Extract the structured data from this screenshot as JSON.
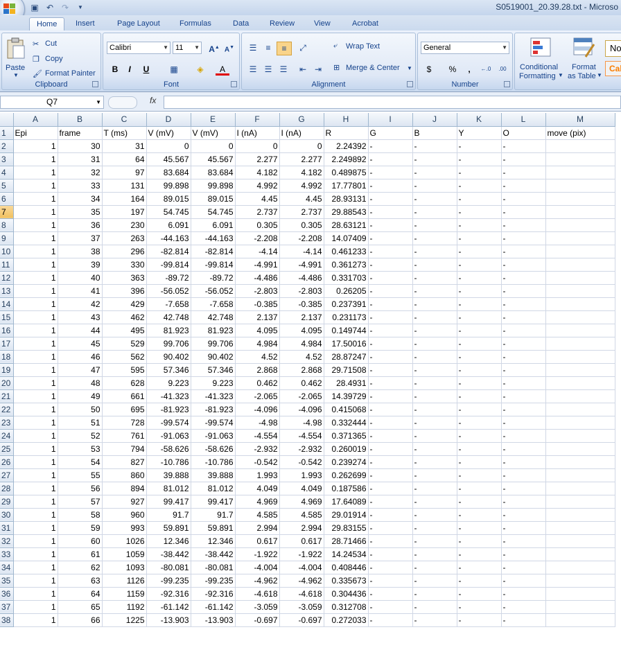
{
  "window": {
    "title": "S0519001_20.39.28.txt - Microso"
  },
  "tabs": [
    "Home",
    "Insert",
    "Page Layout",
    "Formulas",
    "Data",
    "Review",
    "View",
    "Acrobat"
  ],
  "clipboard": {
    "paste": "Paste",
    "cut": "Cut",
    "copy": "Copy",
    "format_painter": "Format Painter",
    "label": "Clipboard"
  },
  "font": {
    "name": "Calibri",
    "size": "11",
    "label": "Font"
  },
  "alignment": {
    "wrap_text": "Wrap Text",
    "merge_center": "Merge & Center",
    "label": "Alignment"
  },
  "number": {
    "format": "General",
    "label": "Number",
    "currency": "$",
    "percent": "%",
    "comma": ","
  },
  "styles": {
    "conditional": "Conditional",
    "conditional2": "Formatting",
    "format_as": "Format",
    "format_as2": "as Table",
    "normal": "No",
    "calc": "Cal"
  },
  "formula_bar": {
    "name_box": "Q7",
    "fx": "fx",
    "formula": ""
  },
  "sheet": {
    "columns": [
      "A",
      "B",
      "C",
      "D",
      "E",
      "F",
      "G",
      "H",
      "I",
      "J",
      "K",
      "L",
      "M"
    ],
    "header_row": [
      "Epi",
      "frame",
      "T (ms)",
      "V (mV)",
      "V (mV)",
      "I (nA)",
      "I (nA)",
      "R",
      "G",
      "B",
      "Y",
      "O",
      "move (pix)"
    ],
    "rows": [
      [
        "1",
        "30",
        "31",
        "0",
        "0",
        "0",
        "0",
        "2.24392",
        "-",
        "-",
        "-",
        "-",
        ""
      ],
      [
        "1",
        "31",
        "64",
        "45.567",
        "45.567",
        "2.277",
        "2.277",
        "2.249892",
        "-",
        "-",
        "-",
        "-",
        ""
      ],
      [
        "1",
        "32",
        "97",
        "83.684",
        "83.684",
        "4.182",
        "4.182",
        "0.489875",
        "-",
        "-",
        "-",
        "-",
        ""
      ],
      [
        "1",
        "33",
        "131",
        "99.898",
        "99.898",
        "4.992",
        "4.992",
        "17.77801",
        "-",
        "-",
        "-",
        "-",
        ""
      ],
      [
        "1",
        "34",
        "164",
        "89.015",
        "89.015",
        "4.45",
        "4.45",
        "28.93131",
        "-",
        "-",
        "-",
        "-",
        ""
      ],
      [
        "1",
        "35",
        "197",
        "54.745",
        "54.745",
        "2.737",
        "2.737",
        "29.88543",
        "-",
        "-",
        "-",
        "-",
        ""
      ],
      [
        "1",
        "36",
        "230",
        "6.091",
        "6.091",
        "0.305",
        "0.305",
        "28.63121",
        "-",
        "-",
        "-",
        "-",
        ""
      ],
      [
        "1",
        "37",
        "263",
        "-44.163",
        "-44.163",
        "-2.208",
        "-2.208",
        "14.07409",
        "-",
        "-",
        "-",
        "-",
        ""
      ],
      [
        "1",
        "38",
        "296",
        "-82.814",
        "-82.814",
        "-4.14",
        "-4.14",
        "0.461233",
        "-",
        "-",
        "-",
        "-",
        ""
      ],
      [
        "1",
        "39",
        "330",
        "-99.814",
        "-99.814",
        "-4.991",
        "-4.991",
        "0.361273",
        "-",
        "-",
        "-",
        "-",
        ""
      ],
      [
        "1",
        "40",
        "363",
        "-89.72",
        "-89.72",
        "-4.486",
        "-4.486",
        "0.331703",
        "-",
        "-",
        "-",
        "-",
        ""
      ],
      [
        "1",
        "41",
        "396",
        "-56.052",
        "-56.052",
        "-2.803",
        "-2.803",
        "0.26205",
        "-",
        "-",
        "-",
        "-",
        ""
      ],
      [
        "1",
        "42",
        "429",
        "-7.658",
        "-7.658",
        "-0.385",
        "-0.385",
        "0.237391",
        "-",
        "-",
        "-",
        "-",
        ""
      ],
      [
        "1",
        "43",
        "462",
        "42.748",
        "42.748",
        "2.137",
        "2.137",
        "0.231173",
        "-",
        "-",
        "-",
        "-",
        ""
      ],
      [
        "1",
        "44",
        "495",
        "81.923",
        "81.923",
        "4.095",
        "4.095",
        "0.149744",
        "-",
        "-",
        "-",
        "-",
        ""
      ],
      [
        "1",
        "45",
        "529",
        "99.706",
        "99.706",
        "4.984",
        "4.984",
        "17.50016",
        "-",
        "-",
        "-",
        "-",
        ""
      ],
      [
        "1",
        "46",
        "562",
        "90.402",
        "90.402",
        "4.52",
        "4.52",
        "28.87247",
        "-",
        "-",
        "-",
        "-",
        ""
      ],
      [
        "1",
        "47",
        "595",
        "57.346",
        "57.346",
        "2.868",
        "2.868",
        "29.71508",
        "-",
        "-",
        "-",
        "-",
        ""
      ],
      [
        "1",
        "48",
        "628",
        "9.223",
        "9.223",
        "0.462",
        "0.462",
        "28.4931",
        "-",
        "-",
        "-",
        "-",
        ""
      ],
      [
        "1",
        "49",
        "661",
        "-41.323",
        "-41.323",
        "-2.065",
        "-2.065",
        "14.39729",
        "-",
        "-",
        "-",
        "-",
        ""
      ],
      [
        "1",
        "50",
        "695",
        "-81.923",
        "-81.923",
        "-4.096",
        "-4.096",
        "0.415068",
        "-",
        "-",
        "-",
        "-",
        ""
      ],
      [
        "1",
        "51",
        "728",
        "-99.574",
        "-99.574",
        "-4.98",
        "-4.98",
        "0.332444",
        "-",
        "-",
        "-",
        "-",
        ""
      ],
      [
        "1",
        "52",
        "761",
        "-91.063",
        "-91.063",
        "-4.554",
        "-4.554",
        "0.371365",
        "-",
        "-",
        "-",
        "-",
        ""
      ],
      [
        "1",
        "53",
        "794",
        "-58.626",
        "-58.626",
        "-2.932",
        "-2.932",
        "0.260019",
        "-",
        "-",
        "-",
        "-",
        ""
      ],
      [
        "1",
        "54",
        "827",
        "-10.786",
        "-10.786",
        "-0.542",
        "-0.542",
        "0.239274",
        "-",
        "-",
        "-",
        "-",
        ""
      ],
      [
        "1",
        "55",
        "860",
        "39.888",
        "39.888",
        "1.993",
        "1.993",
        "0.262699",
        "-",
        "-",
        "-",
        "-",
        ""
      ],
      [
        "1",
        "56",
        "894",
        "81.012",
        "81.012",
        "4.049",
        "4.049",
        "0.187586",
        "-",
        "-",
        "-",
        "-",
        ""
      ],
      [
        "1",
        "57",
        "927",
        "99.417",
        "99.417",
        "4.969",
        "4.969",
        "17.64089",
        "-",
        "-",
        "-",
        "-",
        ""
      ],
      [
        "1",
        "58",
        "960",
        "91.7",
        "91.7",
        "4.585",
        "4.585",
        "29.01914",
        "-",
        "-",
        "-",
        "-",
        ""
      ],
      [
        "1",
        "59",
        "993",
        "59.891",
        "59.891",
        "2.994",
        "2.994",
        "29.83155",
        "-",
        "-",
        "-",
        "-",
        ""
      ],
      [
        "1",
        "60",
        "1026",
        "12.346",
        "12.346",
        "0.617",
        "0.617",
        "28.71466",
        "-",
        "-",
        "-",
        "-",
        ""
      ],
      [
        "1",
        "61",
        "1059",
        "-38.442",
        "-38.442",
        "-1.922",
        "-1.922",
        "14.24534",
        "-",
        "-",
        "-",
        "-",
        ""
      ],
      [
        "1",
        "62",
        "1093",
        "-80.081",
        "-80.081",
        "-4.004",
        "-4.004",
        "0.408446",
        "-",
        "-",
        "-",
        "-",
        ""
      ],
      [
        "1",
        "63",
        "1126",
        "-99.235",
        "-99.235",
        "-4.962",
        "-4.962",
        "0.335673",
        "-",
        "-",
        "-",
        "-",
        ""
      ],
      [
        "1",
        "64",
        "1159",
        "-92.316",
        "-92.316",
        "-4.618",
        "-4.618",
        "0.304436",
        "-",
        "-",
        "-",
        "-",
        ""
      ],
      [
        "1",
        "65",
        "1192",
        "-61.142",
        "-61.142",
        "-3.059",
        "-3.059",
        "0.312708",
        "-",
        "-",
        "-",
        "-",
        ""
      ],
      [
        "1",
        "66",
        "1225",
        "-13.903",
        "-13.903",
        "-0.697",
        "-0.697",
        "0.272033",
        "-",
        "-",
        "-",
        "-",
        ""
      ]
    ]
  },
  "colors": {
    "selected_header": "#f1c15f",
    "ribbon_text": "#15428b",
    "gridline": "#d0d7e5"
  }
}
